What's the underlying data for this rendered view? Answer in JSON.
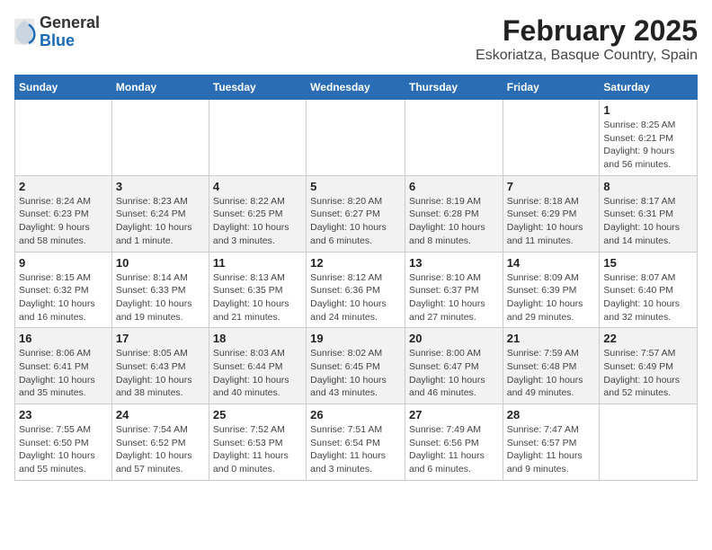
{
  "header": {
    "logo": {
      "general": "General",
      "blue": "Blue"
    },
    "title": "February 2025",
    "subtitle": "Eskoriatza, Basque Country, Spain"
  },
  "weekdays": [
    "Sunday",
    "Monday",
    "Tuesday",
    "Wednesday",
    "Thursday",
    "Friday",
    "Saturday"
  ],
  "weeks": [
    [
      {
        "day": "",
        "info": ""
      },
      {
        "day": "",
        "info": ""
      },
      {
        "day": "",
        "info": ""
      },
      {
        "day": "",
        "info": ""
      },
      {
        "day": "",
        "info": ""
      },
      {
        "day": "",
        "info": ""
      },
      {
        "day": "1",
        "info": "Sunrise: 8:25 AM\nSunset: 6:21 PM\nDaylight: 9 hours\nand 56 minutes."
      }
    ],
    [
      {
        "day": "2",
        "info": "Sunrise: 8:24 AM\nSunset: 6:23 PM\nDaylight: 9 hours\nand 58 minutes."
      },
      {
        "day": "3",
        "info": "Sunrise: 8:23 AM\nSunset: 6:24 PM\nDaylight: 10 hours\nand 1 minute."
      },
      {
        "day": "4",
        "info": "Sunrise: 8:22 AM\nSunset: 6:25 PM\nDaylight: 10 hours\nand 3 minutes."
      },
      {
        "day": "5",
        "info": "Sunrise: 8:20 AM\nSunset: 6:27 PM\nDaylight: 10 hours\nand 6 minutes."
      },
      {
        "day": "6",
        "info": "Sunrise: 8:19 AM\nSunset: 6:28 PM\nDaylight: 10 hours\nand 8 minutes."
      },
      {
        "day": "7",
        "info": "Sunrise: 8:18 AM\nSunset: 6:29 PM\nDaylight: 10 hours\nand 11 minutes."
      },
      {
        "day": "8",
        "info": "Sunrise: 8:17 AM\nSunset: 6:31 PM\nDaylight: 10 hours\nand 14 minutes."
      }
    ],
    [
      {
        "day": "9",
        "info": "Sunrise: 8:15 AM\nSunset: 6:32 PM\nDaylight: 10 hours\nand 16 minutes."
      },
      {
        "day": "10",
        "info": "Sunrise: 8:14 AM\nSunset: 6:33 PM\nDaylight: 10 hours\nand 19 minutes."
      },
      {
        "day": "11",
        "info": "Sunrise: 8:13 AM\nSunset: 6:35 PM\nDaylight: 10 hours\nand 21 minutes."
      },
      {
        "day": "12",
        "info": "Sunrise: 8:12 AM\nSunset: 6:36 PM\nDaylight: 10 hours\nand 24 minutes."
      },
      {
        "day": "13",
        "info": "Sunrise: 8:10 AM\nSunset: 6:37 PM\nDaylight: 10 hours\nand 27 minutes."
      },
      {
        "day": "14",
        "info": "Sunrise: 8:09 AM\nSunset: 6:39 PM\nDaylight: 10 hours\nand 29 minutes."
      },
      {
        "day": "15",
        "info": "Sunrise: 8:07 AM\nSunset: 6:40 PM\nDaylight: 10 hours\nand 32 minutes."
      }
    ],
    [
      {
        "day": "16",
        "info": "Sunrise: 8:06 AM\nSunset: 6:41 PM\nDaylight: 10 hours\nand 35 minutes."
      },
      {
        "day": "17",
        "info": "Sunrise: 8:05 AM\nSunset: 6:43 PM\nDaylight: 10 hours\nand 38 minutes."
      },
      {
        "day": "18",
        "info": "Sunrise: 8:03 AM\nSunset: 6:44 PM\nDaylight: 10 hours\nand 40 minutes."
      },
      {
        "day": "19",
        "info": "Sunrise: 8:02 AM\nSunset: 6:45 PM\nDaylight: 10 hours\nand 43 minutes."
      },
      {
        "day": "20",
        "info": "Sunrise: 8:00 AM\nSunset: 6:47 PM\nDaylight: 10 hours\nand 46 minutes."
      },
      {
        "day": "21",
        "info": "Sunrise: 7:59 AM\nSunset: 6:48 PM\nDaylight: 10 hours\nand 49 minutes."
      },
      {
        "day": "22",
        "info": "Sunrise: 7:57 AM\nSunset: 6:49 PM\nDaylight: 10 hours\nand 52 minutes."
      }
    ],
    [
      {
        "day": "23",
        "info": "Sunrise: 7:55 AM\nSunset: 6:50 PM\nDaylight: 10 hours\nand 55 minutes."
      },
      {
        "day": "24",
        "info": "Sunrise: 7:54 AM\nSunset: 6:52 PM\nDaylight: 10 hours\nand 57 minutes."
      },
      {
        "day": "25",
        "info": "Sunrise: 7:52 AM\nSunset: 6:53 PM\nDaylight: 11 hours\nand 0 minutes."
      },
      {
        "day": "26",
        "info": "Sunrise: 7:51 AM\nSunset: 6:54 PM\nDaylight: 11 hours\nand 3 minutes."
      },
      {
        "day": "27",
        "info": "Sunrise: 7:49 AM\nSunset: 6:56 PM\nDaylight: 11 hours\nand 6 minutes."
      },
      {
        "day": "28",
        "info": "Sunrise: 7:47 AM\nSunset: 6:57 PM\nDaylight: 11 hours\nand 9 minutes."
      },
      {
        "day": "",
        "info": ""
      }
    ]
  ]
}
